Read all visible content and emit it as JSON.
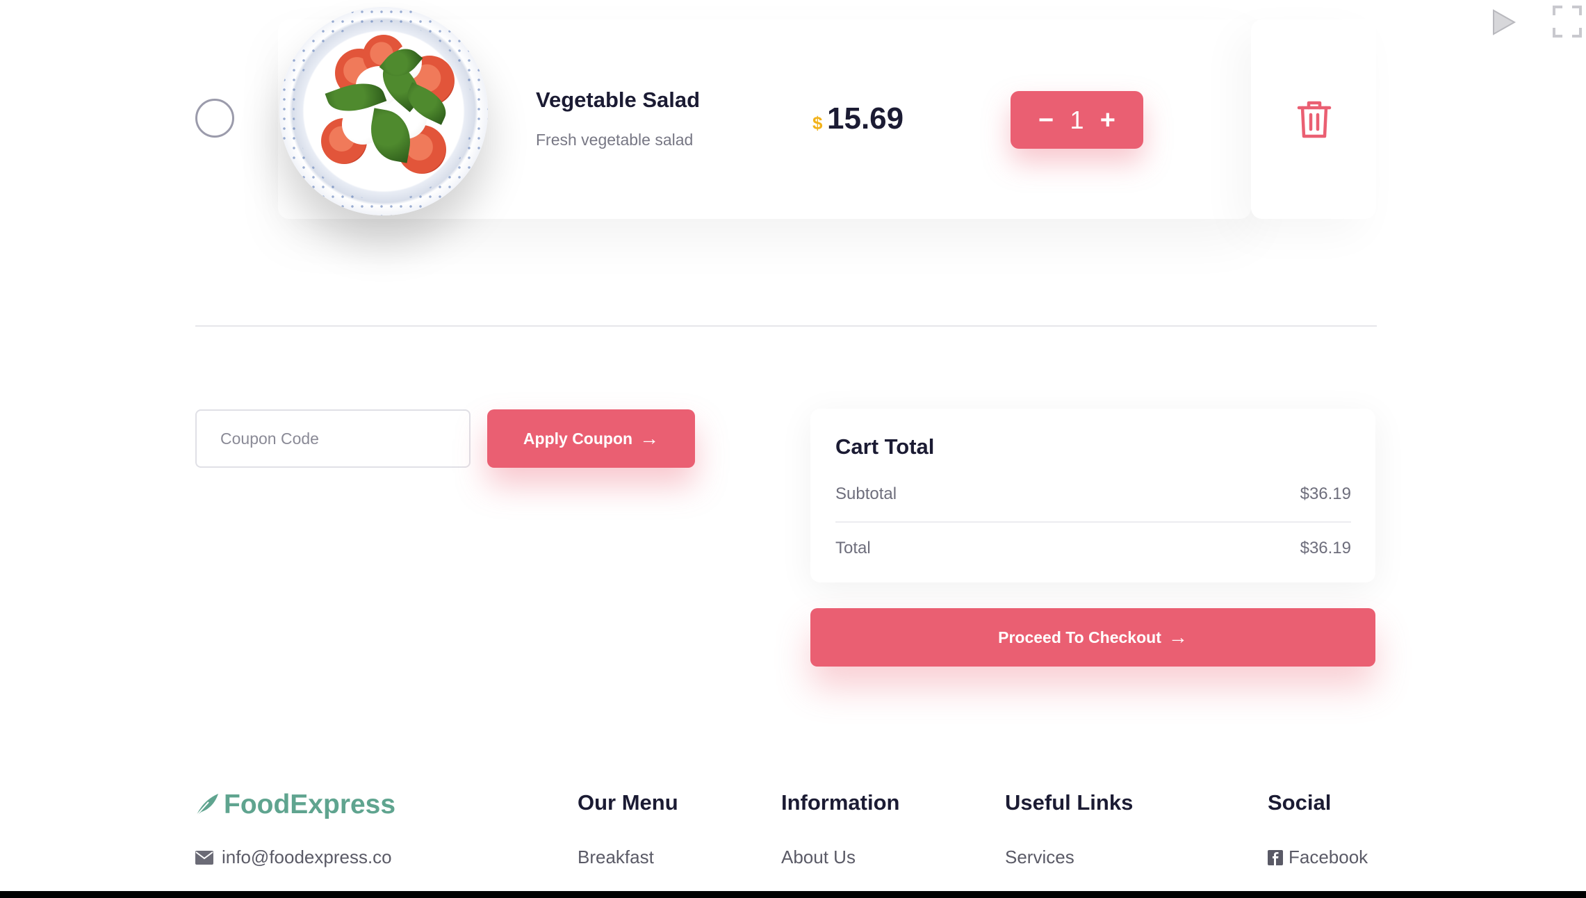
{
  "cart_item": {
    "name": "Vegetable Salad",
    "description": "Fresh vegetable salad",
    "price_currency": "$",
    "price_value": "15.69",
    "quantity": "1",
    "decrease_symbol": "−",
    "increase_symbol": "+",
    "image_icon": "salad-plate-image"
  },
  "coupon": {
    "placeholder": "Coupon Code",
    "apply_label": "Apply Coupon",
    "arrow": "→"
  },
  "cart_total": {
    "title": "Cart Total",
    "subtotal_label": "Subtotal",
    "subtotal_value": "$36.19",
    "total_label": "Total",
    "total_value": "$36.19"
  },
  "checkout": {
    "label": "Proceed To Checkout",
    "arrow": "→"
  },
  "footer": {
    "brand": "FoodExpress",
    "email": "info@foodexpress.co",
    "columns": [
      {
        "heading": "Our Menu",
        "link": "Breakfast"
      },
      {
        "heading": "Information",
        "link": "About Us"
      },
      {
        "heading": "Useful Links",
        "link": "Services"
      },
      {
        "heading": "Social",
        "link": "Facebook"
      }
    ]
  },
  "colors": {
    "accent": "#ea5f72",
    "brand": "#5fa48f",
    "currency": "#f2b21a"
  }
}
